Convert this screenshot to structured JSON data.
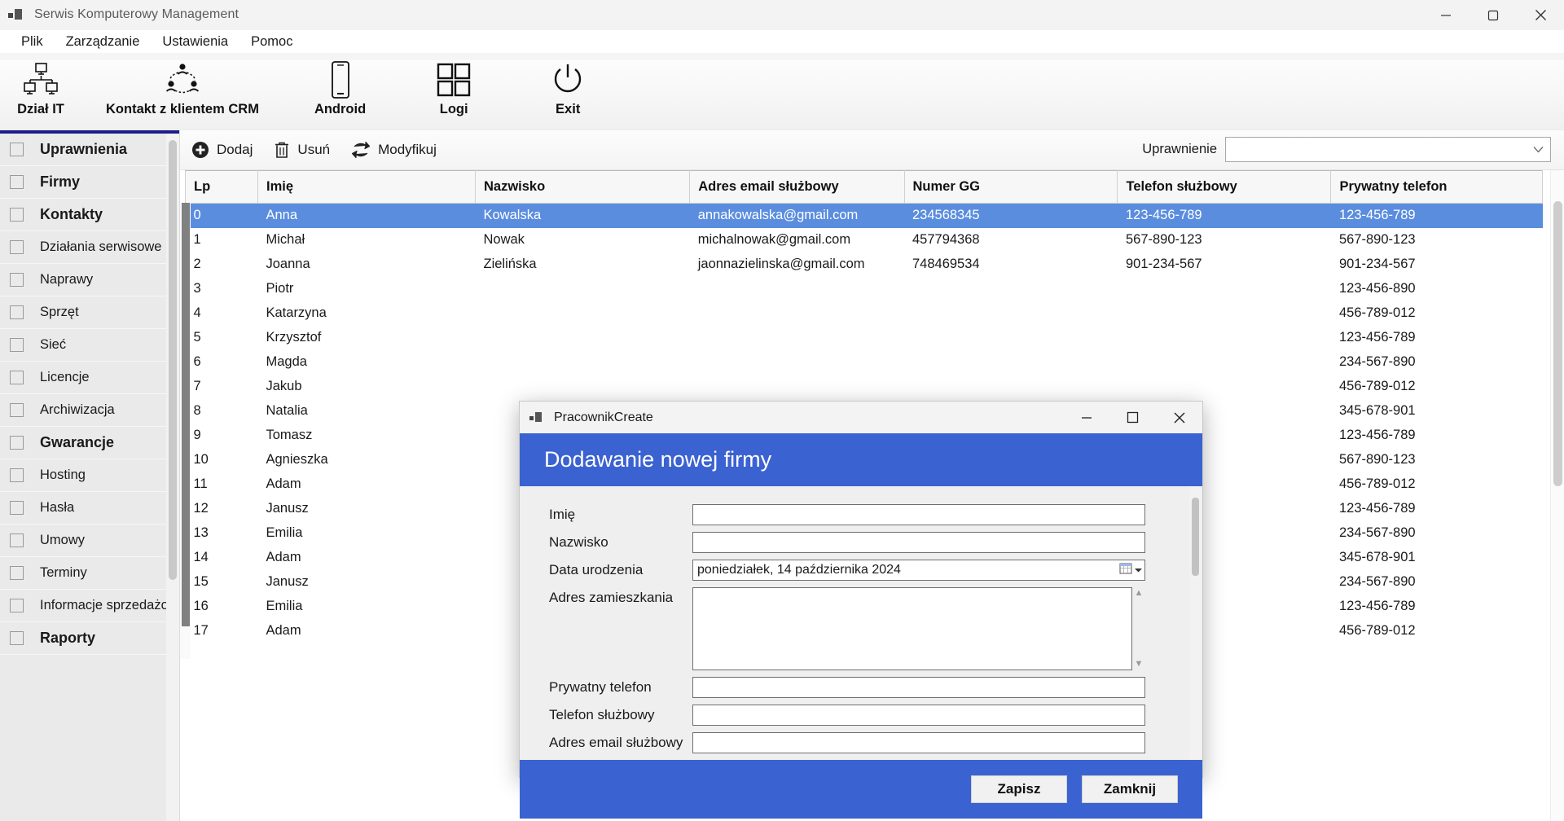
{
  "window": {
    "title": "Serwis Komputerowy Management",
    "icon": "app-icon",
    "minimize": "minimize-icon",
    "maximize": "maximize-icon",
    "close": "close-icon"
  },
  "menu": {
    "items": [
      {
        "label": "Plik"
      },
      {
        "label": "Zarządzanie"
      },
      {
        "label": "Ustawienia"
      },
      {
        "label": "Pomoc"
      }
    ]
  },
  "ribbon": {
    "buttons": [
      {
        "label": "Dział IT",
        "icon": "network-computers-icon"
      },
      {
        "label": "Kontakt z klientem CRM",
        "icon": "people-network-icon"
      },
      {
        "label": "Android",
        "icon": "smartphone-icon"
      },
      {
        "label": "Logi",
        "icon": "grid-squares-icon"
      },
      {
        "label": "Exit",
        "icon": "power-icon"
      }
    ]
  },
  "sidebar": {
    "items": [
      {
        "label": "Uprawnienia",
        "bold": true
      },
      {
        "label": "Firmy",
        "bold": true
      },
      {
        "label": "Kontakty",
        "bold": true
      },
      {
        "label": "Działania serwisowe",
        "bold": false
      },
      {
        "label": "Naprawy",
        "bold": false
      },
      {
        "label": "Sprzęt",
        "bold": false
      },
      {
        "label": "Sieć",
        "bold": false
      },
      {
        "label": "Licencje",
        "bold": false
      },
      {
        "label": "Archiwizacja",
        "bold": false
      },
      {
        "label": "Gwarancje",
        "bold": true
      },
      {
        "label": "Hosting",
        "bold": false
      },
      {
        "label": "Hasła",
        "bold": false
      },
      {
        "label": "Umowy",
        "bold": false
      },
      {
        "label": "Terminy",
        "bold": false
      },
      {
        "label": "Informacje sprzedażowe",
        "bold": false
      },
      {
        "label": "Raporty",
        "bold": true
      }
    ]
  },
  "command_bar": {
    "add_label": "Dodaj",
    "delete_label": "Usuń",
    "modify_label": "Modyfikuj",
    "permission_label": "Uprawnienie",
    "permission_value": "",
    "permission_placeholder": ""
  },
  "table": {
    "columns": [
      "Lp",
      "Imię",
      "Nazwisko",
      "Adres email służbowy",
      "Numer GG",
      "Telefon służbowy",
      "Prywatny telefon"
    ],
    "rows": [
      {
        "lp": "0",
        "imie": "Anna",
        "nazwisko": "Kowalska",
        "email": "annakowalska@gmail.com",
        "gg": "234568345",
        "tel_sluzbowy": "123-456-789",
        "tel_prywatny": "123-456-789",
        "selected": true
      },
      {
        "lp": "1",
        "imie": "Michał",
        "nazwisko": "Nowak",
        "email": "michalnowak@gmail.com",
        "gg": "457794368",
        "tel_sluzbowy": "567-890-123",
        "tel_prywatny": "567-890-123",
        "selected": false
      },
      {
        "lp": "2",
        "imie": "Joanna",
        "nazwisko": "Zielińska",
        "email": "jaonnazielinska@gmail.com",
        "gg": "748469534",
        "tel_sluzbowy": "901-234-567",
        "tel_prywatny": "901-234-567",
        "selected": false
      },
      {
        "lp": "3",
        "imie": "Piotr",
        "nazwisko": "",
        "email": "",
        "gg": "",
        "tel_sluzbowy": "",
        "tel_prywatny": "123-456-890",
        "selected": false
      },
      {
        "lp": "4",
        "imie": "Katarzyna",
        "nazwisko": "",
        "email": "",
        "gg": "",
        "tel_sluzbowy": "",
        "tel_prywatny": "456-789-012",
        "selected": false
      },
      {
        "lp": "5",
        "imie": "Krzysztof",
        "nazwisko": "",
        "email": "",
        "gg": "",
        "tel_sluzbowy": "",
        "tel_prywatny": "123-456-789",
        "selected": false
      },
      {
        "lp": "6",
        "imie": "Magda",
        "nazwisko": "",
        "email": "",
        "gg": "",
        "tel_sluzbowy": "",
        "tel_prywatny": "234-567-890",
        "selected": false
      },
      {
        "lp": "7",
        "imie": "Jakub",
        "nazwisko": "",
        "email": "",
        "gg": "",
        "tel_sluzbowy": "",
        "tel_prywatny": "456-789-012",
        "selected": false
      },
      {
        "lp": "8",
        "imie": "Natalia",
        "nazwisko": "",
        "email": "",
        "gg": "",
        "tel_sluzbowy": "",
        "tel_prywatny": "345-678-901",
        "selected": false
      },
      {
        "lp": "9",
        "imie": "Tomasz",
        "nazwisko": "",
        "email": "",
        "gg": "",
        "tel_sluzbowy": "",
        "tel_prywatny": "123-456-789",
        "selected": false
      },
      {
        "lp": "10",
        "imie": "Agnieszka",
        "nazwisko": "",
        "email": "",
        "gg": "",
        "tel_sluzbowy": "",
        "tel_prywatny": "567-890-123",
        "selected": false
      },
      {
        "lp": "11",
        "imie": "Adam",
        "nazwisko": "",
        "email": "",
        "gg": "",
        "tel_sluzbowy": "",
        "tel_prywatny": "456-789-012",
        "selected": false
      },
      {
        "lp": "12",
        "imie": "Janusz",
        "nazwisko": "",
        "email": "",
        "gg": "",
        "tel_sluzbowy": "",
        "tel_prywatny": "123-456-789",
        "selected": false
      },
      {
        "lp": "13",
        "imie": "Emilia",
        "nazwisko": "",
        "email": "",
        "gg": "",
        "tel_sluzbowy": "",
        "tel_prywatny": "234-567-890",
        "selected": false
      },
      {
        "lp": "14",
        "imie": "Adam",
        "nazwisko": "",
        "email": "",
        "gg": "",
        "tel_sluzbowy": "",
        "tel_prywatny": "345-678-901",
        "selected": false
      },
      {
        "lp": "15",
        "imie": "Janusz",
        "nazwisko": "",
        "email": "",
        "gg": "",
        "tel_sluzbowy": "",
        "tel_prywatny": "234-567-890",
        "selected": false
      },
      {
        "lp": "16",
        "imie": "Emilia",
        "nazwisko": "",
        "email": "",
        "gg": "",
        "tel_sluzbowy": "",
        "tel_prywatny": "123-456-789",
        "selected": false
      },
      {
        "lp": "17",
        "imie": "Adam",
        "nazwisko": "",
        "email": "",
        "gg": "",
        "tel_sluzbowy": "",
        "tel_prywatny": "456-789-012",
        "selected": false
      }
    ]
  },
  "dialog": {
    "window_title": "PracownikCreate",
    "header_title": "Dodawanie nowej firmy",
    "fields": {
      "imie_label": "Imię",
      "imie_value": "",
      "nazwisko_label": "Nazwisko",
      "nazwisko_value": "",
      "data_urodzenia_label": "Data urodzenia",
      "data_urodzenia_value": "poniedziałek, 14 października 2024",
      "adres_label": "Adres zamieszkania",
      "adres_value": "",
      "prywatny_telefon_label": "Prywatny telefon",
      "prywatny_telefon_value": "",
      "telefon_sluzbowy_label": "Telefon służbowy",
      "telefon_sluzbowy_value": "",
      "email_label": "Adres email służbowy",
      "email_value": ""
    },
    "save_label": "Zapisz",
    "close_label": "Zamknij"
  },
  "colors": {
    "accent": "#3b62d1",
    "selection": "#5b8dde",
    "sidebar_top_bar": "#1c1c8c",
    "sidebar_bg": "#eaeaea"
  }
}
